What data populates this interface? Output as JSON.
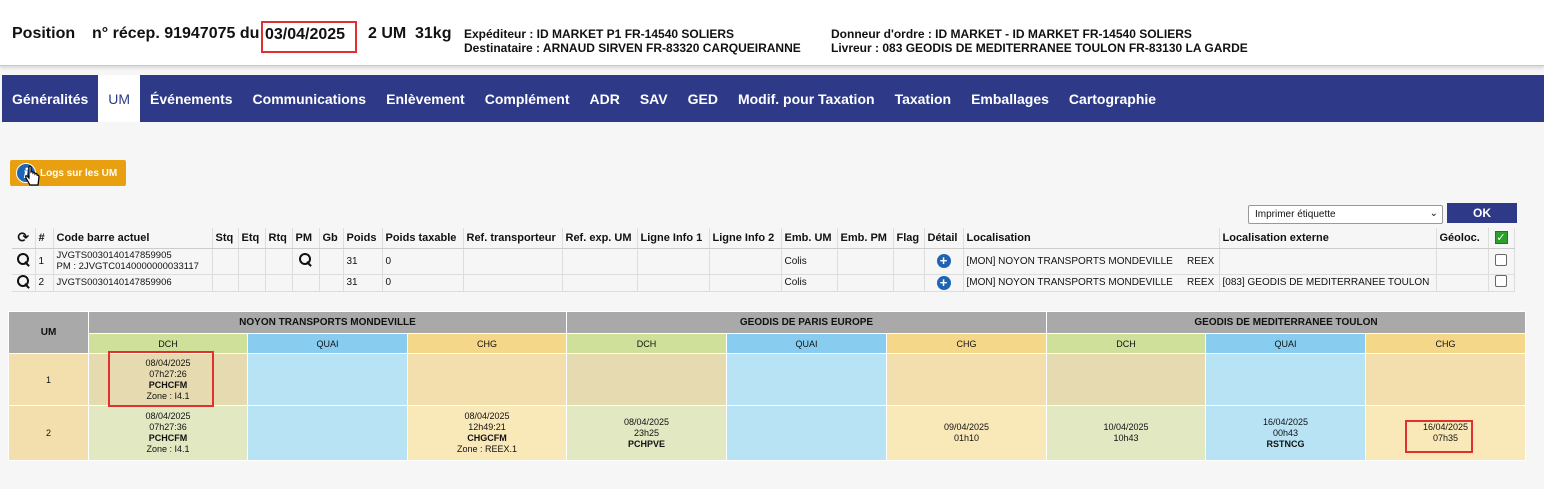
{
  "header": {
    "title": "Position",
    "recep_prefix": "n° récep. 91947075 du",
    "date": "03/04/2025",
    "um_count": "2 UM",
    "weight": "31kg",
    "expediteur": "Expéditeur : ID MARKET P1 FR-14540 SOLIERS",
    "destinataire": "Destinataire : ARNAUD SIRVEN FR-83320 CARQUEIRANNE",
    "donneur": "Donneur d'ordre : ID MARKET - ID MARKET FR-14540 SOLIERS",
    "livreur": "Livreur : 083 GEODIS DE MEDITERRANEE TOULON FR-83130 LA GARDE"
  },
  "nav": {
    "items": [
      "Généralités",
      "UM",
      "Événements",
      "Communications",
      "Enlèvement",
      "Complément",
      "ADR",
      "SAV",
      "GED",
      "Modif. pour Taxation",
      "Taxation",
      "Emballages",
      "Cartographie"
    ],
    "active": "UM"
  },
  "logs_button": "Logs sur les UM",
  "print": {
    "selected": "Imprimer étiquette",
    "ok": "OK"
  },
  "um_table": {
    "columns": [
      "#",
      "Code barre actuel",
      "Stq",
      "Etq",
      "Rtq",
      "PM",
      "Gb",
      "Poids",
      "Poids taxable",
      "Ref. transporteur",
      "Ref. exp. UM",
      "Ligne Info 1",
      "Ligne Info 2",
      "Emb. UM",
      "Emb. PM",
      "Flag",
      "Détail",
      "Localisation",
      "Localisation externe",
      "Géoloc."
    ],
    "rows": [
      {
        "num": "1",
        "code": "JVGTS0030140147859905",
        "code2": "PM : 2JVGTC0140000000033117",
        "poids": "31",
        "poids_taxable": "0",
        "emb_um": "Colis",
        "localisation": "[MON] NOYON TRANSPORTS MONDEVILLE",
        "reex": "REEX",
        "loc_externe": ""
      },
      {
        "num": "2",
        "code": "JVGTS0030140147859906",
        "code2": "",
        "poids": "31",
        "poids_taxable": "0",
        "emb_um": "Colis",
        "localisation": "[MON] NOYON TRANSPORTS MONDEVILLE",
        "reex": "REEX",
        "loc_externe": "[083] GEODIS DE MEDITERRANEE TOULON"
      }
    ]
  },
  "tracking": {
    "um_label": "UM",
    "sites": [
      "NOYON TRANSPORTS MONDEVILLE",
      "GEODIS DE PARIS EUROPE",
      "GEODIS DE MEDITERRANEE TOULON"
    ],
    "steps": [
      "DCH",
      "QUAI",
      "CHG"
    ],
    "rows": [
      {
        "um": "1",
        "cells": [
          [
            "08/04/2025",
            "07h27:26",
            "PCHCFM",
            "Zone : I4.1"
          ],
          [],
          [],
          [],
          [],
          [],
          [],
          [],
          []
        ]
      },
      {
        "um": "2",
        "cells": [
          [
            "08/04/2025",
            "07h27:36",
            "PCHCFM",
            "Zone : I4.1"
          ],
          [],
          [
            "08/04/2025",
            "12h49:21",
            "CHGCFM",
            "Zone : REEX.1"
          ],
          [
            "08/04/2025",
            "23h25",
            "PCHPVE"
          ],
          [],
          [
            "09/04/2025",
            "01h10"
          ],
          [
            "10/04/2025",
            "10h43"
          ],
          [
            "16/04/2025",
            "00h43",
            "RSTNCG"
          ],
          [
            "16/04/2025",
            "07h35"
          ]
        ]
      }
    ]
  }
}
